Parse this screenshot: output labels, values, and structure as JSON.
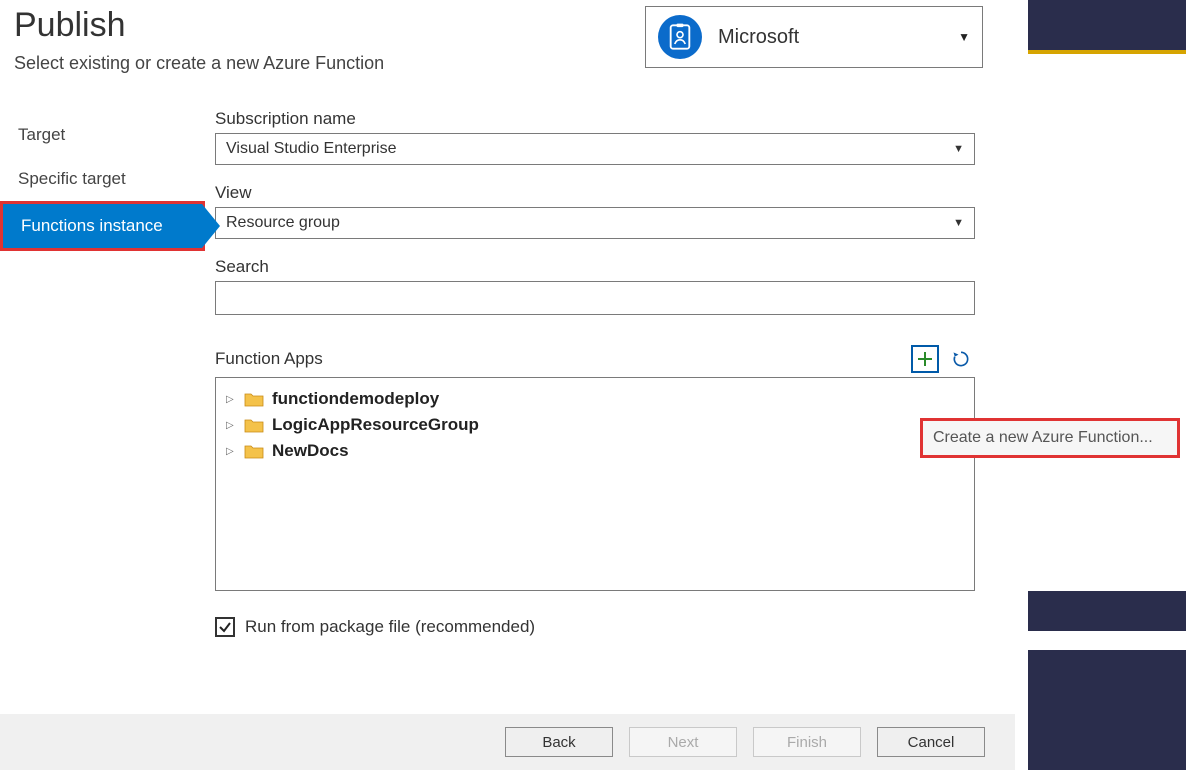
{
  "header": {
    "title": "Publish",
    "subtitle": "Select existing or create a new Azure Function"
  },
  "account": {
    "name": "Microsoft"
  },
  "sidebar": {
    "items": [
      {
        "label": "Target"
      },
      {
        "label": "Specific target"
      },
      {
        "label": "Functions instance"
      }
    ]
  },
  "form": {
    "subscription_label": "Subscription name",
    "subscription_value": "Visual Studio Enterprise",
    "view_label": "View",
    "view_value": "Resource group",
    "search_label": "Search",
    "search_value": "",
    "function_apps_label": "Function Apps",
    "tree": [
      {
        "label": "functiondemodeploy"
      },
      {
        "label": "LogicAppResourceGroup"
      },
      {
        "label": "NewDocs"
      }
    ],
    "checkbox_label": "Run from package file (recommended)",
    "checkbox_checked": true
  },
  "tooltip": "Create a new Azure Function...",
  "buttons": {
    "back": "Back",
    "next": "Next",
    "finish": "Finish",
    "cancel": "Cancel"
  }
}
